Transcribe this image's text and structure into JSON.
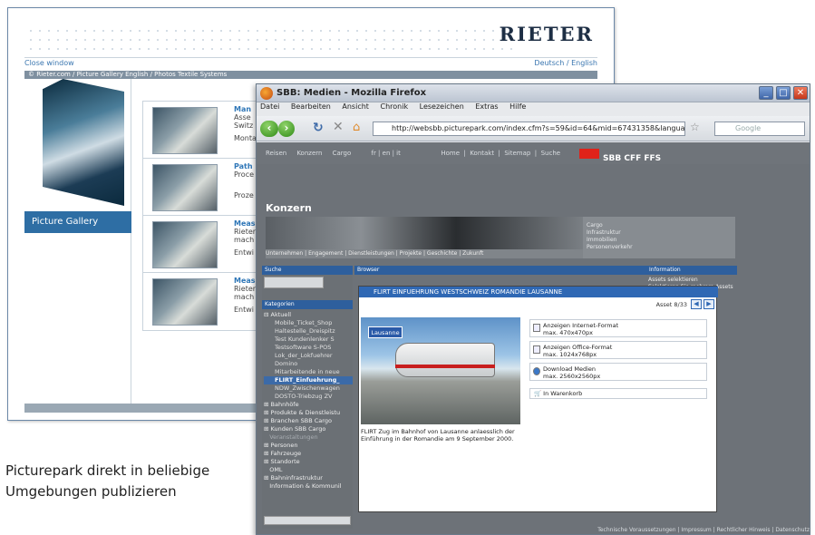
{
  "rieter": {
    "logo": "RIETER",
    "close_window": "Close window",
    "language": "Deutsch / English",
    "breadcrumb": "© Rieter.com / Picture Gallery English   / Photos Textile Systems",
    "gallery_button": "Picture Gallery",
    "items": [
      {
        "title": "Man",
        "line1": "Asse",
        "line2": "Switz",
        "line3": "Monta Syste"
      },
      {
        "title": "Path",
        "line1": "Proce",
        "line2": "",
        "line3": "Proze"
      },
      {
        "title": "Meas",
        "line1": "Rieter",
        "line2": "mach",
        "line3": "Entwi"
      },
      {
        "title": "Meas",
        "line1": "Rieter",
        "line2": "mach",
        "line3": "Entwi"
      }
    ]
  },
  "caption": {
    "line1": "Picturepark direkt in beliebige",
    "line2": "Umgebungen publizieren"
  },
  "firefox": {
    "title": "SBB: Medien - Mozilla Firefox",
    "menu": [
      "Datei",
      "Bearbeiten",
      "Ansicht",
      "Chronik",
      "Lesezeichen",
      "Extras",
      "Hilfe"
    ],
    "url": "http://websbb.picturepark.com/index.cfm?s=59&id=64&mid=67431358&language=de&c",
    "search_placeholder": "Google"
  },
  "sbb": {
    "topnav": "Reisen     Konzern     Cargo          fr | en | it                    Home  |  Kontakt  |  Sitemap  |  Suche",
    "brand": "SBB CFF FFS",
    "page_title": "Konzern",
    "banner_nav": "Unternehmen  |  Engagement  |  Dienstleistungen  |  Projekte  |  Geschichte  |  Zukunft",
    "right_links": [
      "Cargo",
      "Infrastruktur",
      "Immobilien",
      "Personenverkehr"
    ],
    "search_label": "Suche",
    "categories_label": "Kategorien",
    "browser_label": "Browser",
    "info_label": "Information",
    "info_text": "Assets selektieren\nSelektieren Sie mehrere Assets",
    "tree_top": "Aktuell",
    "tree_sub": [
      "Mobile_Ticket_Shop",
      "Haltestelle_Dreispitz",
      "Test Kundenlenker S",
      "Testsoftware S-POS",
      "Lok_der_Lokfuehrer",
      "Domino",
      "Mitarbeitende in neue",
      "FLIRT_Einfuehrung_",
      "NDW_Zwischenwagen",
      "DOSTO-Triebzug ZV"
    ],
    "tree_sections": [
      "Bahnhöfe",
      "Produkte & Dienstleistu",
      "Branchen SBB Cargo",
      "Kunden SBB Cargo",
      "Veranstaltungen",
      "Personen",
      "Fahrzeuge",
      "Standorte",
      "OML",
      "Bahninfrastruktur",
      "Information & Kommunil"
    ],
    "footer": "Technische Voraussetzungen  |  Impressum  |  Rechtlicher Hinweis  |  Datenschutz"
  },
  "modal": {
    "title": "FLIRT EINFUEHRUNG WESTSCHWEIZ ROMANDIE LAUSANNE",
    "asset_counter": "Asset 8/33",
    "photo_sign": "Lausanne",
    "photo_caption": "FLIRT Zug im Bahnhof von Lausanne anlaesslich der Einführung in der Romandie am 9 September 2000.",
    "options": [
      {
        "title": "Anzeigen Internet-Format",
        "sub": "max. 470x470px"
      },
      {
        "title": "Anzeigen Office-Format",
        "sub": "max. 1024x768px"
      },
      {
        "title": "Download Medien",
        "sub": "max. 2560x2560px"
      }
    ],
    "cart": "In Warenkorb"
  }
}
